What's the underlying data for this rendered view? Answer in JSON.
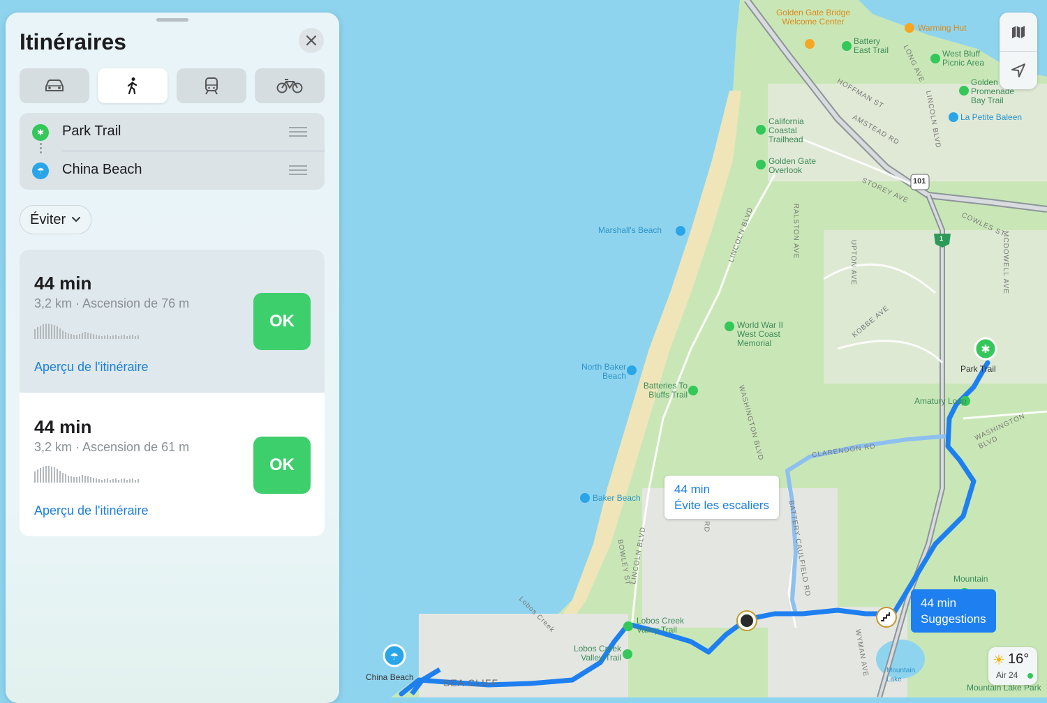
{
  "panel": {
    "title": "Itinéraires",
    "transport_modes": [
      "car",
      "walk",
      "transit",
      "bike"
    ],
    "selected_mode": "walk",
    "origin": "Park Trail",
    "destination": "China Beach",
    "avoid_label": "Éviter",
    "routes": [
      {
        "time": "44 min",
        "details": "3,2 km · Ascension de 76 m",
        "preview": "Aperçu de l'itinéraire",
        "button": "OK",
        "selected": true
      },
      {
        "time": "44 min",
        "details": "3,2 km · Ascension de 61 m",
        "preview": "Aperçu de l'itinéraire",
        "button": "OK",
        "selected": false
      }
    ]
  },
  "map": {
    "callouts": {
      "alt": {
        "time": "44 min",
        "note": "Évite les escaliers"
      },
      "main": {
        "time": "44 min",
        "note": "Suggestions"
      }
    },
    "places": {
      "golden_gate_center": "Golden Gate Bridge Welcome Center",
      "battery_east": "Battery East Trail",
      "warming_hut": "Warming Hut",
      "west_bluff": "West Bluff Picnic Area",
      "promenade": "Golden Promenade Bay Trail",
      "petite_baleen": "La Petite Baleen",
      "california_coastal": "California Coastal Trailhead",
      "gg_overlook": "Golden Gate Overlook",
      "marshalls": "Marshall's Beach",
      "wwii": "World War II West Coast Memorial",
      "north_baker": "North Baker Beach",
      "batteries_bluffs": "Batteries To Bluffs Trail",
      "baker_beach": "Baker Beach",
      "park_trail": "Park Trail",
      "amatury": "Amatury Loop",
      "lobos_creek_valley": "Lobos Creek Valley Trail",
      "lobos_creek_valley2": "Lobos Creek Valley Trail",
      "china_beach": "China Beach",
      "sea_cliff": "SEA CLIFF",
      "mountain": "Mountain",
      "mountain_lake": "Mountain Lake",
      "mountain_lake2": "Mountain Lake Park"
    },
    "roads": [
      "LINCOLN BLVD",
      "WASHINGTON BLVD",
      "KOBBE AVE",
      "BATTERY CAULFIELD RD",
      "CLARENDON RD",
      "WASHINGTON BLVD",
      "MCDOWELL AVE",
      "COWLES ST",
      "STOREY AVE",
      "RALSTON AVE",
      "UPTON AVE",
      "HOFFMAN ST",
      "AMSTEAD RD",
      "LINCOLN BLVD",
      "LONG AVE",
      "WYMAN AVE",
      "LINCOLN BLVD",
      "BOWLEY ST",
      "Lobos Creek",
      "EL RD"
    ],
    "highway_shields": [
      "101",
      "1"
    ],
    "weather": {
      "temp": "16°",
      "air": "Air 24"
    }
  },
  "colors": {
    "route": "#1e7ff0",
    "water": "#8fd4ef",
    "land": "#c9e7b6",
    "ok": "#3ecf6d",
    "link": "#1c7fdc"
  }
}
